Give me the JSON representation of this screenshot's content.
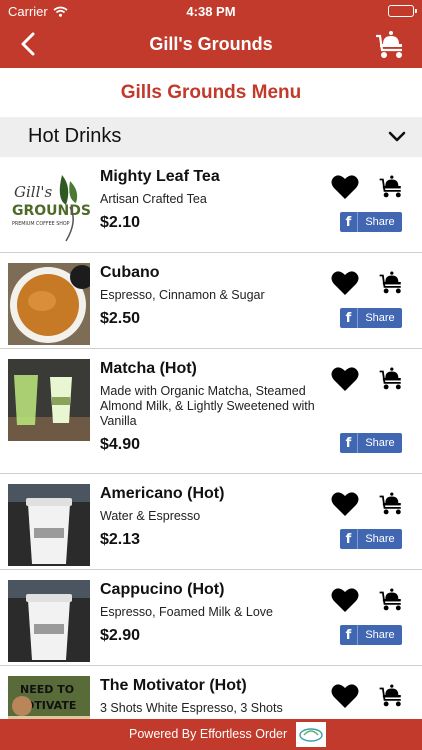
{
  "status": {
    "carrier": "Carrier",
    "time": "4:38 PM"
  },
  "nav": {
    "title": "Gill's Grounds"
  },
  "menu_title": "Gills Grounds Menu",
  "section": {
    "title": "Hot Drinks"
  },
  "share_label": "Share",
  "items": [
    {
      "name": "Mighty Leaf Tea",
      "desc": "Artisan Crafted Tea",
      "price": "$2.10",
      "thumb": "logo"
    },
    {
      "name": "Cubano",
      "desc": "Espresso, Cinnamon & Sugar",
      "price": "$2.50",
      "thumb": "cubano-photo"
    },
    {
      "name": "Matcha (Hot)",
      "desc": "Made with Organic Matcha, Steamed Almond Milk, & Lightly Sweetened with Vanilla",
      "price": "$4.90",
      "thumb": "matcha-photo"
    },
    {
      "name": "Americano (Hot)",
      "desc": "Water & Espresso",
      "price": "$2.13",
      "thumb": "cup-photo"
    },
    {
      "name": "Cappucino (Hot)",
      "desc": "Espresso, Foamed Milk & Love",
      "price": "$2.90",
      "thumb": "cup-photo"
    },
    {
      "name": "The Motivator (Hot)",
      "desc": "3 Shots White Espresso, 3 Shots",
      "price": "",
      "thumb": "sign-photo"
    }
  ],
  "logo": {
    "line1": "Gill's",
    "line2": "GROUNDS",
    "line3": "PREMIUM COFFEE SHOP"
  },
  "sign": {
    "line1": "NEED TO",
    "line2": "MOTIVATE"
  },
  "footer": {
    "text": "Powered By Effortless Order"
  },
  "colors": {
    "brand": "#c23a2b",
    "facebook": "#4267b2",
    "section_bg": "#eeeeee"
  },
  "icons": {
    "heart": "heart-icon",
    "cart": "serving-cart-icon",
    "back": "back-chevron-icon",
    "chevron": "chevron-down-icon"
  }
}
